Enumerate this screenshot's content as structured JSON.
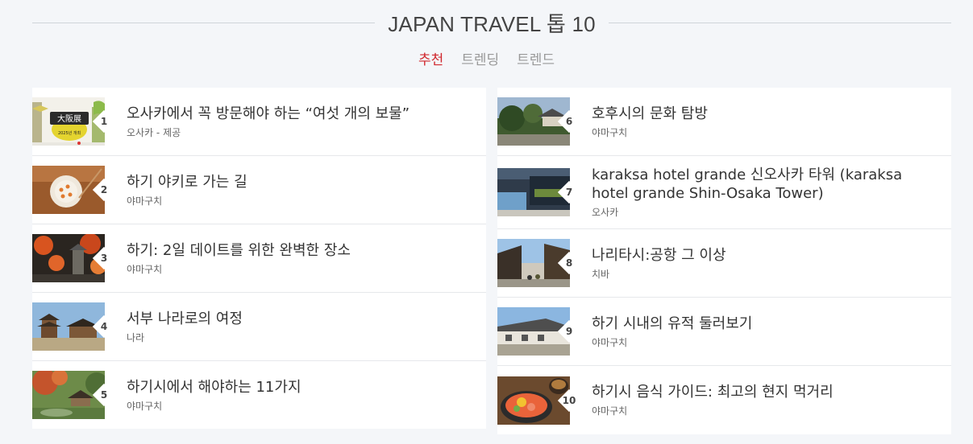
{
  "header": {
    "title": "JAPAN TRAVEL 톱 10"
  },
  "tabs": [
    {
      "label": "추천"
    },
    {
      "label": "트렌딩"
    },
    {
      "label": "트렌드"
    }
  ],
  "colors": {
    "accent": "#d0282e",
    "background": "#f4f6f9"
  },
  "left_items": [
    {
      "rank": "1",
      "title": "오사카에서 꼭 방문해야 하는 “여섯 개의 보물”",
      "sub": "오사카 - 제공",
      "image_text": "大阪展",
      "image_caption": "2025년 개최"
    },
    {
      "rank": "2",
      "title": "하기 야키로 가는 길",
      "sub": "야마구치"
    },
    {
      "rank": "3",
      "title": "하기: 2일 데이트를 위한 완벽한 장소",
      "sub": "야마구치"
    },
    {
      "rank": "4",
      "title": "서부 나라로의 여정",
      "sub": "나라"
    },
    {
      "rank": "5",
      "title": "하기시에서 해야하는 11가지",
      "sub": "야마구치"
    }
  ],
  "right_items": [
    {
      "rank": "6",
      "title": "호후시의 문화 탐방",
      "sub": "야마구치"
    },
    {
      "rank": "7",
      "title": "karaksa hotel grande 신오사카 타워 (karaksa hotel grande Shin-Osaka Tower)",
      "sub": "오사카"
    },
    {
      "rank": "8",
      "title": "나리타시:공항 그 이상",
      "sub": "치바"
    },
    {
      "rank": "9",
      "title": "하기 시내의 유적 둘러보기",
      "sub": "야마구치"
    },
    {
      "rank": "10",
      "title": "하기시 음식 가이드: 최고의 현지 먹거리",
      "sub": "야마구치"
    }
  ]
}
